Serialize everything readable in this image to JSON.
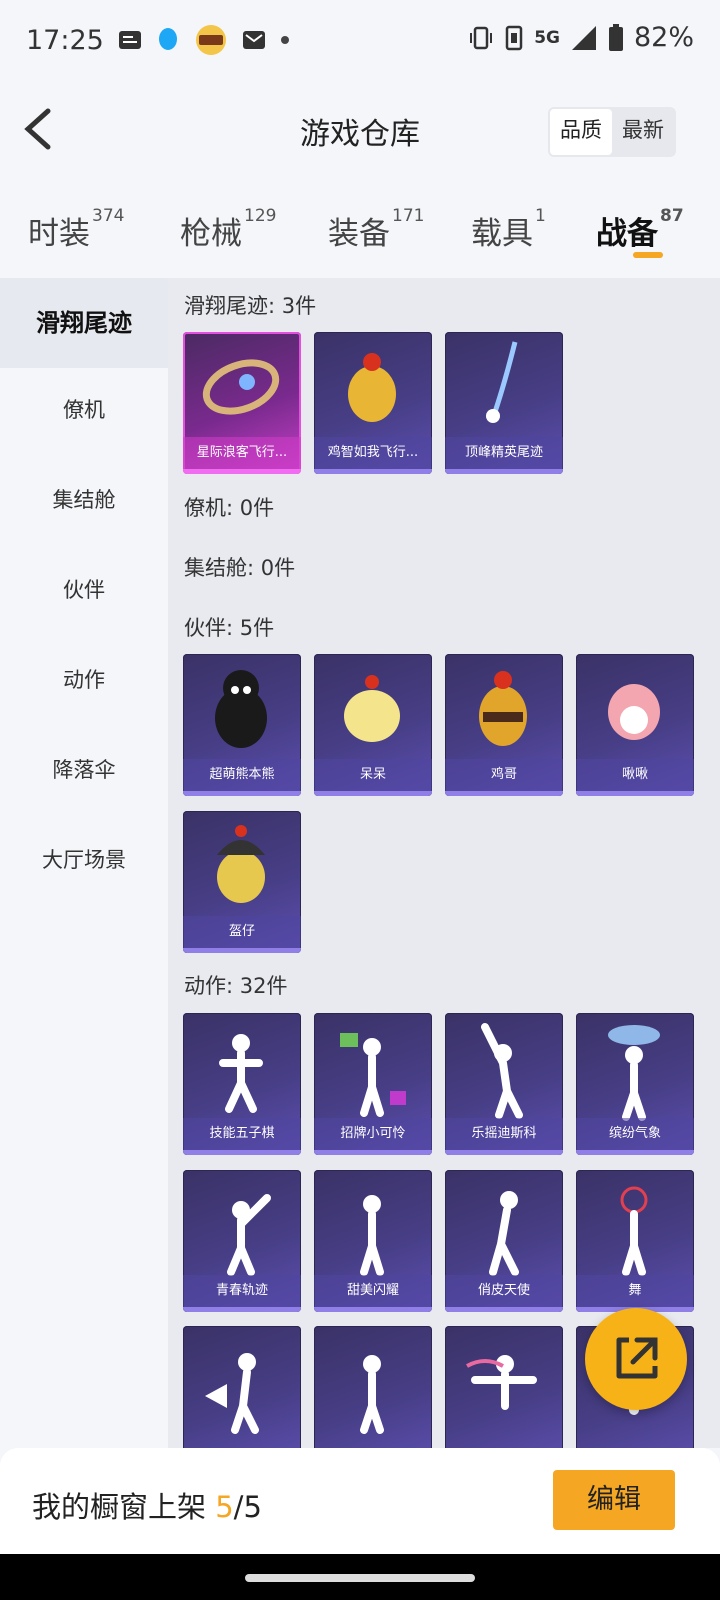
{
  "status": {
    "time": "17:25",
    "network": "5G",
    "battery": "82%"
  },
  "header": {
    "title": "游戏仓库",
    "sort_quality": "品质",
    "sort_newest": "最新"
  },
  "tabs": [
    {
      "label": "时装",
      "count": "374"
    },
    {
      "label": "枪械",
      "count": "129"
    },
    {
      "label": "装备",
      "count": "171"
    },
    {
      "label": "载具",
      "count": "1"
    },
    {
      "label": "战备",
      "count": "87"
    }
  ],
  "sidebar": [
    "滑翔尾迹",
    "僚机",
    "集结舱",
    "伙伴",
    "动作",
    "降落伞",
    "大厅场景"
  ],
  "sections": {
    "trail": {
      "title": "滑翔尾迹: 3件",
      "items": [
        "星际浪客飞行...",
        "鸡智如我飞行...",
        "顶峰精英尾迹"
      ]
    },
    "wingman": {
      "title": "僚机: 0件"
    },
    "pod": {
      "title": "集结舱: 0件"
    },
    "partner": {
      "title": "伙伴: 5件",
      "items": [
        "超萌熊本熊",
        "呆呆",
        "鸡哥",
        "啾啾",
        "盔仔"
      ]
    },
    "emote": {
      "title": "动作: 32件",
      "items": [
        "技能五子棋",
        "招牌小可怜",
        "乐摇迪斯科",
        "缤纷气象",
        "青春轨迹",
        "甜美闪耀",
        "俏皮天使",
        "舞"
      ]
    }
  },
  "bottom": {
    "prefix": "我的橱窗上架 ",
    "current": "5",
    "total": "/5",
    "edit": "编辑"
  },
  "icons": [
    "back-icon",
    "share-icon",
    "figure-icon"
  ],
  "colors": {
    "accent": "#f5a623",
    "card": "#473e86",
    "legendary": "#c640c8"
  }
}
